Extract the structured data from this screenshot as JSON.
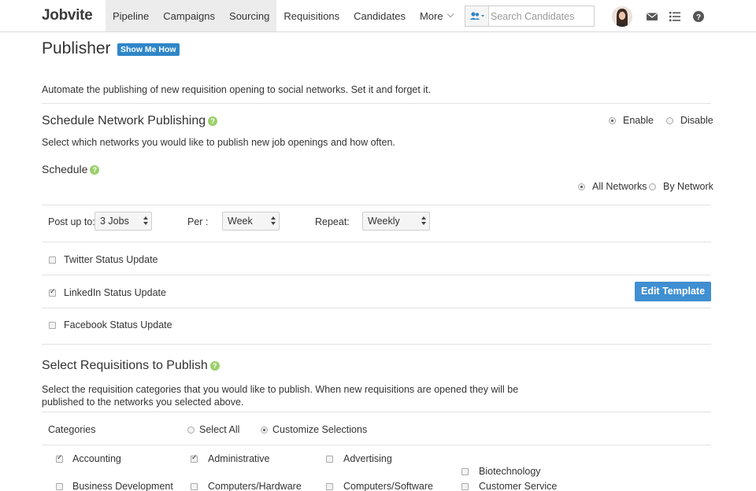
{
  "app": {
    "logo": "Jobvite"
  },
  "nav": {
    "items": [
      "Pipeline",
      "Campaigns",
      "Sourcing",
      "Requisitions",
      "Candidates",
      "More"
    ],
    "search_placeholder": "Search Candidates"
  },
  "page": {
    "title": "Publisher",
    "show_me_how": "Show Me How",
    "description": "Automate the publishing of new requisition opening to social networks. Set it and forget it."
  },
  "schedule_network": {
    "heading": "Schedule Network Publishing",
    "enable_label": "Enable",
    "disable_label": "Disable",
    "enabled": true,
    "description": "Select which networks you would like to publish new job openings and how often.",
    "schedule_heading": "Schedule",
    "all_networks_label": "All Networks",
    "by_network_label": "By Network",
    "all_networks_selected": true,
    "post_up_to_label": "Post up to:",
    "post_up_to_value": "3 Jobs",
    "per_label": "Per :",
    "per_value": "Week",
    "repeat_label": "Repeat:",
    "repeat_value": "Weekly"
  },
  "networks": [
    {
      "label": "Twitter Status Update",
      "checked": false
    },
    {
      "label": "LinkedIn Status Update",
      "checked": true
    },
    {
      "label": "Facebook Status Update",
      "checked": false
    }
  ],
  "edit_template_label": "Edit Template",
  "requisitions": {
    "heading": "Select Requisitions to Publish",
    "description_line1": "Select the requisition categories that you would like to publish. When new requisitions are opened they will be",
    "description_line2": "published to the networks you selected above.",
    "categories_label": "Categories",
    "select_all_label": "Select All",
    "customize_label": "Customize Selections",
    "customize_selected": true,
    "categories": [
      {
        "label": "Accounting",
        "checked": true
      },
      {
        "label": "Administrative",
        "checked": true
      },
      {
        "label": "Advertising",
        "checked": false
      },
      {
        "label": "Biotechnology",
        "checked": false
      },
      {
        "label": "Business Development",
        "checked": false
      },
      {
        "label": "Computers/Hardware",
        "checked": false
      },
      {
        "label": "Computers/Software",
        "checked": false
      },
      {
        "label": "Customer Service",
        "checked": false
      }
    ]
  },
  "icons": {
    "search": "person-search-icon",
    "mail": "envelope-icon",
    "tasks": "list-icon",
    "help": "question-icon"
  },
  "colors": {
    "primary": "#3f8fd2",
    "badge": "#2f86c9",
    "help_green": "#9bcf6b"
  }
}
